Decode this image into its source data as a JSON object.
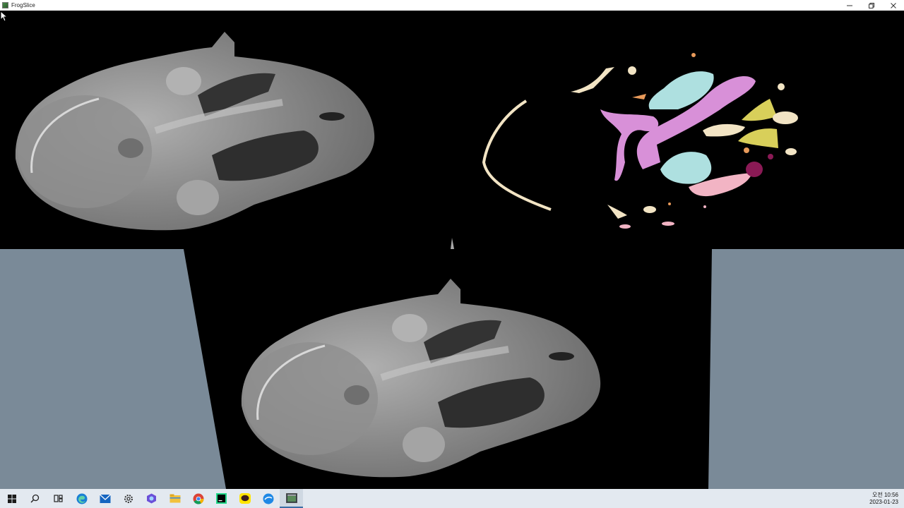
{
  "window": {
    "title": "FrogSlice"
  },
  "taskbar": {
    "apps": [
      {
        "icon": "windows-start-icon"
      },
      {
        "icon": "search-icon"
      },
      {
        "icon": "task-view-icon"
      },
      {
        "icon": "edge-icon"
      },
      {
        "icon": "mail-icon"
      },
      {
        "icon": "settings-icon"
      },
      {
        "icon": "copilot-icon"
      },
      {
        "icon": "file-explorer-icon"
      },
      {
        "icon": "chrome-icon"
      },
      {
        "icon": "pycharm-icon"
      },
      {
        "icon": "kakaotalk-icon"
      },
      {
        "icon": "blue-app-icon"
      },
      {
        "icon": "frogslice-app-icon"
      }
    ],
    "clock": {
      "time": "오전 10:56",
      "date": "2023-01-23"
    }
  },
  "colors": {
    "background": "#000000",
    "floor": "#7a8a98",
    "tissue_cyan": "#aee0e0",
    "tissue_violet": "#d890d8",
    "tissue_yellow": "#d8cf5a",
    "tissue_cream": "#f2e4c4",
    "tissue_pink": "#f2b4c4",
    "tissue_maroon": "#8a1a55",
    "tissue_orange": "#e89a5a"
  }
}
